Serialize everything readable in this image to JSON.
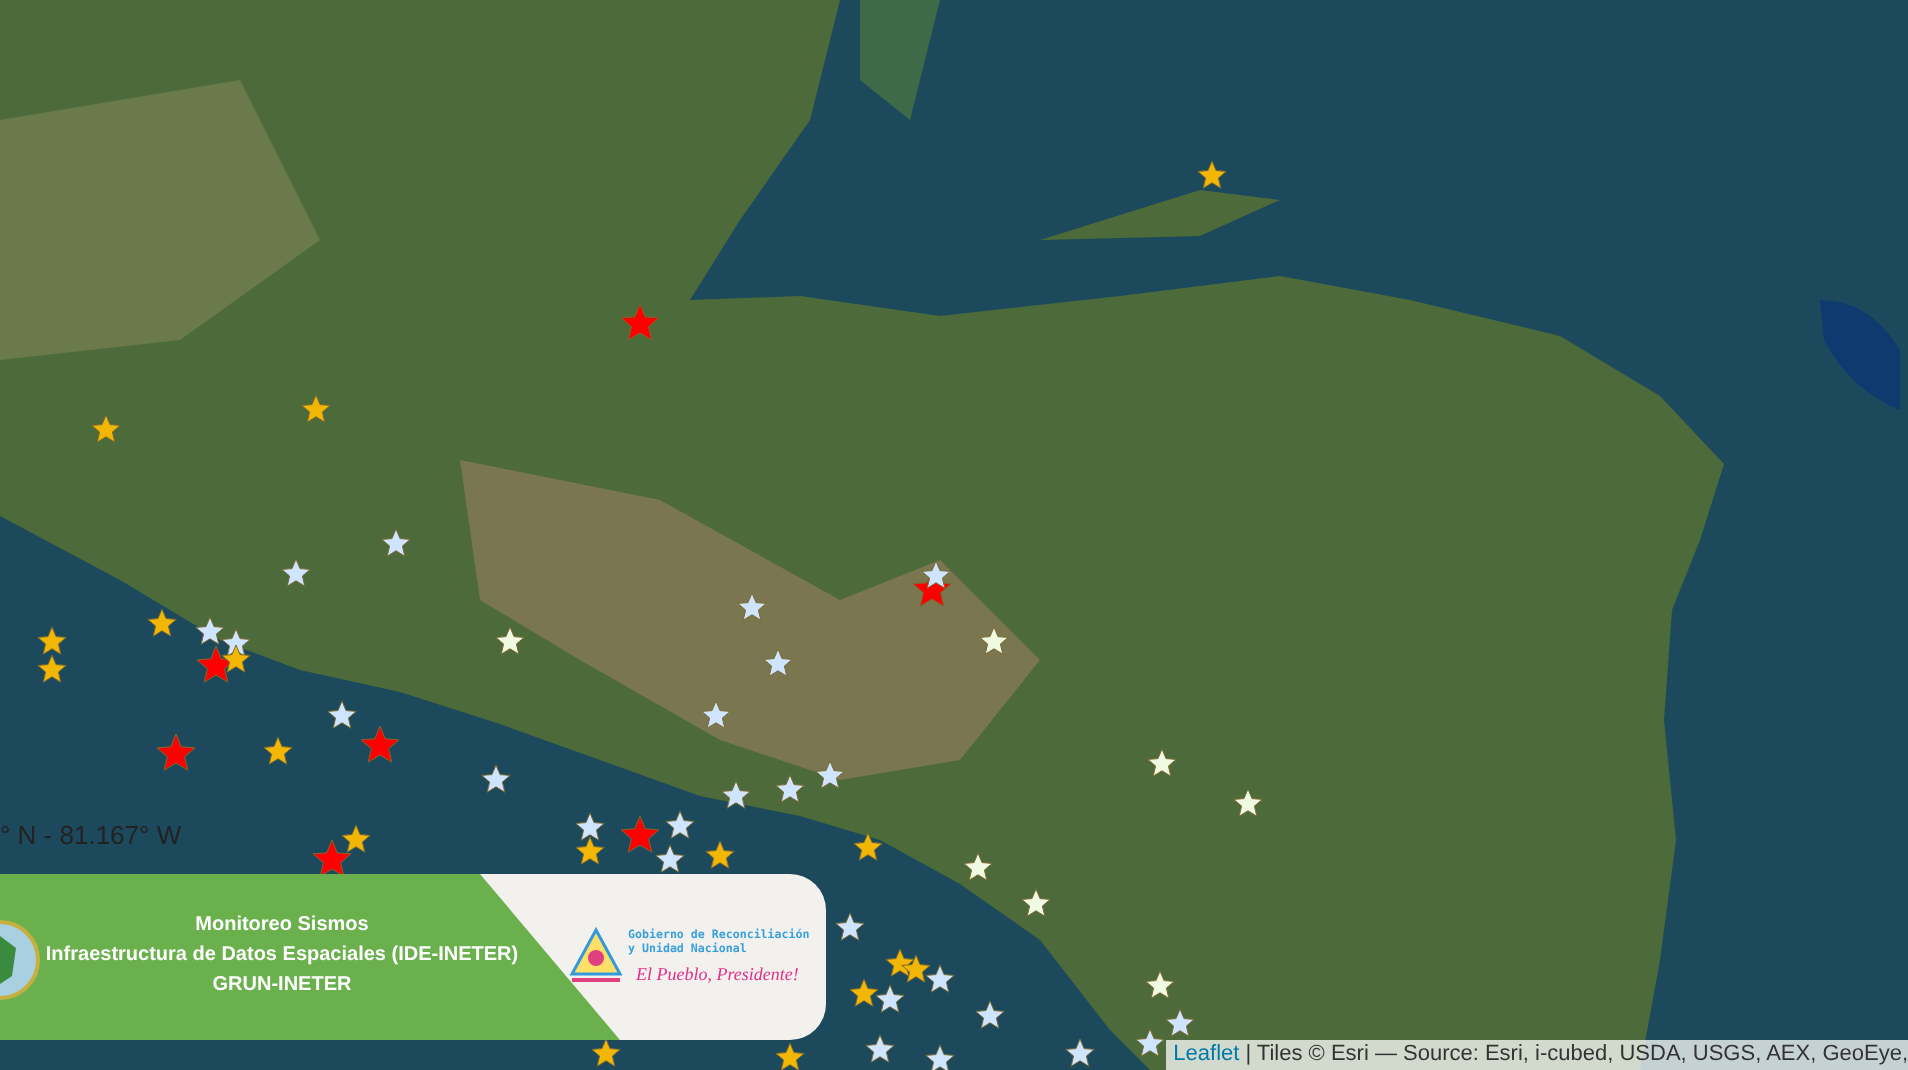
{
  "map": {
    "coordinates": "° N - 81.167° W",
    "attribution": {
      "link": "Leaflet",
      "text": "| Tiles © Esri — Source: Esri, i-cubed, USDA, USGS, AEX, GeoEye,"
    }
  },
  "markers": [
    {
      "color": "#f2b705"
    },
    {
      "color": "#ff0000"
    },
    {
      "color": "#f2b705"
    },
    {
      "color": "#f2b705"
    },
    {
      "color": "#cfe4ff"
    },
    {
      "color": "#cfe4ff"
    },
    {
      "color": "#f2b705"
    },
    {
      "color": "#f2b705"
    },
    {
      "color": "#f2b705"
    },
    {
      "color": "#cfe4ff"
    },
    {
      "color": "#cfe4ff"
    },
    {
      "color": "#ff0000"
    },
    {
      "color": "#f2b705"
    },
    {
      "color": "#ff0000"
    },
    {
      "color": "#f2b705"
    },
    {
      "color": "#ff0000"
    },
    {
      "color": "#cfe4ff"
    },
    {
      "color": "#cfe4ff"
    },
    {
      "color": "#eefbe0"
    },
    {
      "color": "#cfe4ff"
    },
    {
      "color": "#cfe4ff"
    },
    {
      "color": "#cfe4ff"
    },
    {
      "color": "#ff0000"
    },
    {
      "color": "#cfe4ff"
    },
    {
      "color": "#eefbe0"
    },
    {
      "color": "#ff0000"
    },
    {
      "color": "#cfe4ff"
    },
    {
      "color": "#f2b705"
    },
    {
      "color": "#cfe4ff"
    },
    {
      "color": "#cfe4ff"
    },
    {
      "color": "#cfe4ff"
    },
    {
      "color": "#cfe4ff"
    },
    {
      "color": "#f2b705"
    },
    {
      "color": "#f2b705"
    },
    {
      "color": "#cfe4ff"
    },
    {
      "color": "#f2b705"
    },
    {
      "color": "#ff0000"
    },
    {
      "color": "#eefbe0"
    },
    {
      "color": "#eefbe0"
    },
    {
      "color": "#eefbe0"
    },
    {
      "color": "#eefbe0"
    },
    {
      "color": "#cfe4ff"
    },
    {
      "color": "#f2b705"
    },
    {
      "color": "#cfe4ff"
    },
    {
      "color": "#cfe4ff"
    },
    {
      "color": "#cfe4ff"
    },
    {
      "color": "#cfe4ff"
    },
    {
      "color": "#cfe4ff"
    },
    {
      "color": "#cfe4ff"
    },
    {
      "color": "#cfe4ff"
    },
    {
      "color": "#cfe4ff"
    },
    {
      "color": "#f2b705"
    },
    {
      "color": "#f2b705"
    },
    {
      "color": "#f2b705"
    },
    {
      "color": "#f2b705"
    },
    {
      "color": "#eefbe0"
    }
  ],
  "banner": {
    "lines": [
      "Monitoreo Sismos",
      "Infraestructura de Datos Espaciales (IDE-INETER)",
      "GRUN-INETER"
    ],
    "logo_lines": [
      "Gobierno de Reconciliación",
      "y Unidad Nacional"
    ],
    "slogan": "El Pueblo, Presidente!"
  }
}
